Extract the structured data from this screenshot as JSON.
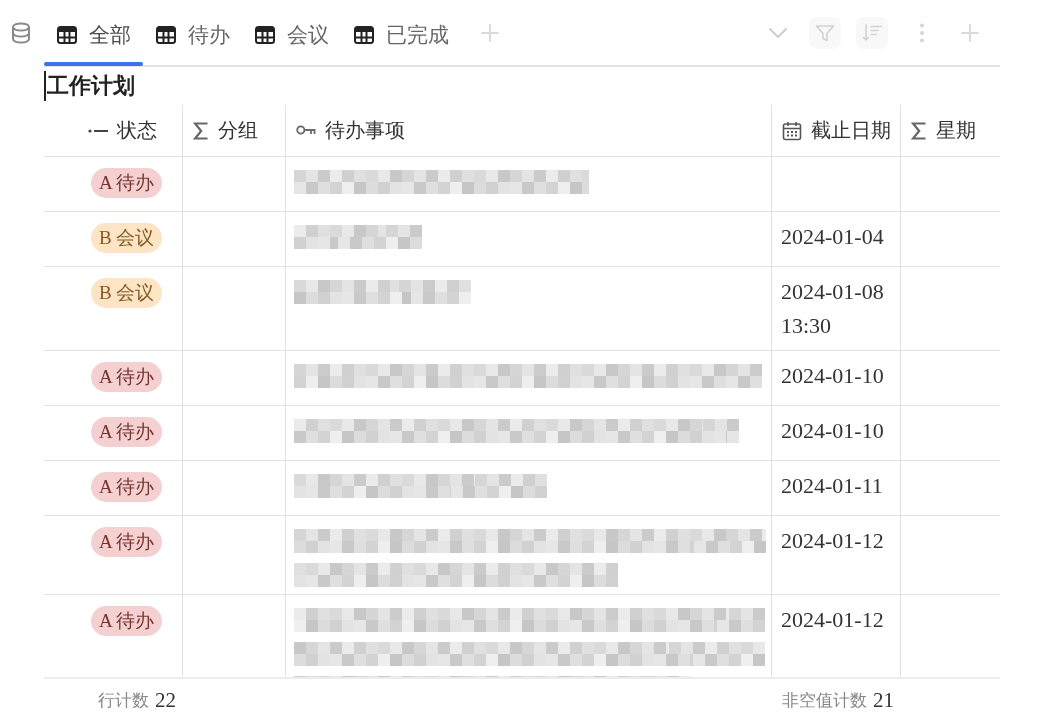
{
  "tabs": [
    {
      "label": "全部",
      "selected": true
    },
    {
      "label": "待办",
      "selected": false
    },
    {
      "label": "会议",
      "selected": false
    },
    {
      "label": "已完成",
      "selected": false
    }
  ],
  "title": {
    "text": "工作计划",
    "caret": true
  },
  "table": {
    "columns": [
      {
        "label": "状态",
        "kind": "single_select"
      },
      {
        "label": "分组",
        "kind": "formula"
      },
      {
        "label": "待办事项",
        "kind": "primary"
      },
      {
        "label": "截止日期",
        "kind": "date"
      },
      {
        "label": "星期",
        "kind": "formula"
      }
    ],
    "rows": [
      {
        "status": {
          "label": "A 待办",
          "color": "#f5d0d0"
        },
        "task": {
          "kind": "blurred"
        }
      },
      {
        "status": {
          "label": "B 会议",
          "color": "#fde4c4"
        },
        "task": {
          "kind": "blurred"
        },
        "due": "2024-01-04"
      },
      {
        "status": {
          "label": "B 会议",
          "color": "#fde4c4"
        },
        "task": {
          "kind": "blurred"
        },
        "due": "2024-01-08 13:30"
      },
      {
        "status": {
          "label": "A 待办",
          "color": "#f5d0d0"
        },
        "task": {
          "kind": "blurred"
        },
        "due": "2024-01-10"
      },
      {
        "status": {
          "label": "A 待办",
          "color": "#f5d0d0"
        },
        "task": {
          "kind": "blurred"
        },
        "due": "2024-01-10"
      },
      {
        "status": {
          "label": "A 待办",
          "color": "#f5d0d0"
        },
        "task": {
          "kind": "blurred"
        },
        "due": "2024-01-11"
      },
      {
        "status": {
          "label": "A 待办",
          "color": "#f5d0d0"
        },
        "task": {
          "kind": "blurred"
        },
        "due": "2024-01-12"
      },
      {
        "status": {
          "label": "A 待办",
          "color": "#f5d0d0"
        },
        "task": {
          "kind": "blurred"
        },
        "due": "2024-01-12"
      }
    ]
  },
  "footer": {
    "row_count": {
      "label": "行计数",
      "value": "22"
    },
    "nonempty_count": {
      "label": "非空值计数",
      "value": "21"
    }
  }
}
